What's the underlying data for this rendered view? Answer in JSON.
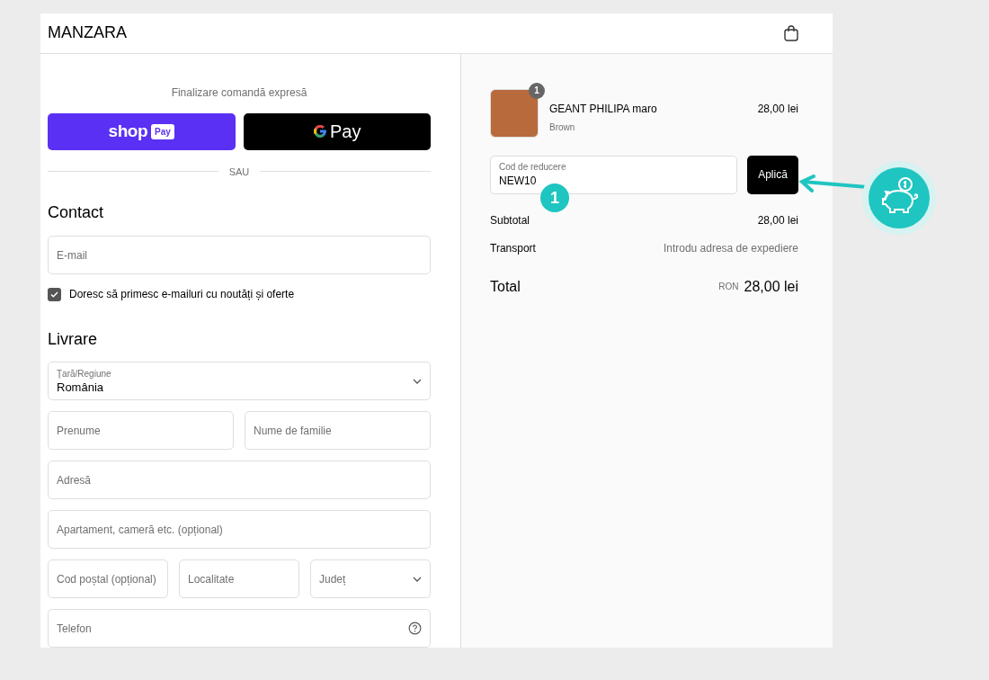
{
  "header": {
    "logo": "MANZARA"
  },
  "express": {
    "title": "Finalizare comandă expresă",
    "shop_pay": {
      "word": "shop",
      "tag": "Pay"
    },
    "google_pay": {
      "word": "Pay"
    },
    "divider": "SAU"
  },
  "contact": {
    "heading": "Contact",
    "email": {
      "placeholder": "E-mail"
    },
    "newsletter": {
      "label": "Doresc să primesc e-mailuri cu noutăți și oferte",
      "checked": true
    }
  },
  "delivery": {
    "heading": "Livrare",
    "rows": [
      [
        {
          "kind": "select",
          "label": "Țară/Regiune",
          "value": "România"
        }
      ],
      [
        {
          "kind": "text",
          "placeholder": "Prenume"
        },
        {
          "kind": "text",
          "placeholder": "Nume de familie"
        }
      ],
      [
        {
          "kind": "text",
          "placeholder": "Adresă"
        }
      ],
      [
        {
          "kind": "text",
          "placeholder": "Apartament, cameră etc. (opțional)"
        }
      ],
      [
        {
          "kind": "text",
          "placeholder": "Cod poștal (opțional)"
        },
        {
          "kind": "text",
          "placeholder": "Localitate"
        },
        {
          "kind": "select",
          "placeholder": "Județ"
        }
      ],
      [
        {
          "kind": "help",
          "placeholder": "Telefon"
        }
      ]
    ]
  },
  "summary": {
    "item": {
      "name": "GEANT PHILIPA maro",
      "variant": "Brown",
      "price": "28,00 lei",
      "quantity": "1"
    },
    "discount": {
      "label": "Cod de reducere",
      "value": "NEW10",
      "button": "Aplică"
    },
    "lines": [
      {
        "label": "Subtotal",
        "value": "28,00 lei",
        "muted": false
      },
      {
        "label": "Transport",
        "value": "Introdu adresa de expediere",
        "muted": true
      }
    ],
    "total": {
      "label": "Total",
      "currency": "RON",
      "value": "28,00 lei"
    }
  },
  "annotation": {
    "step": "1"
  }
}
